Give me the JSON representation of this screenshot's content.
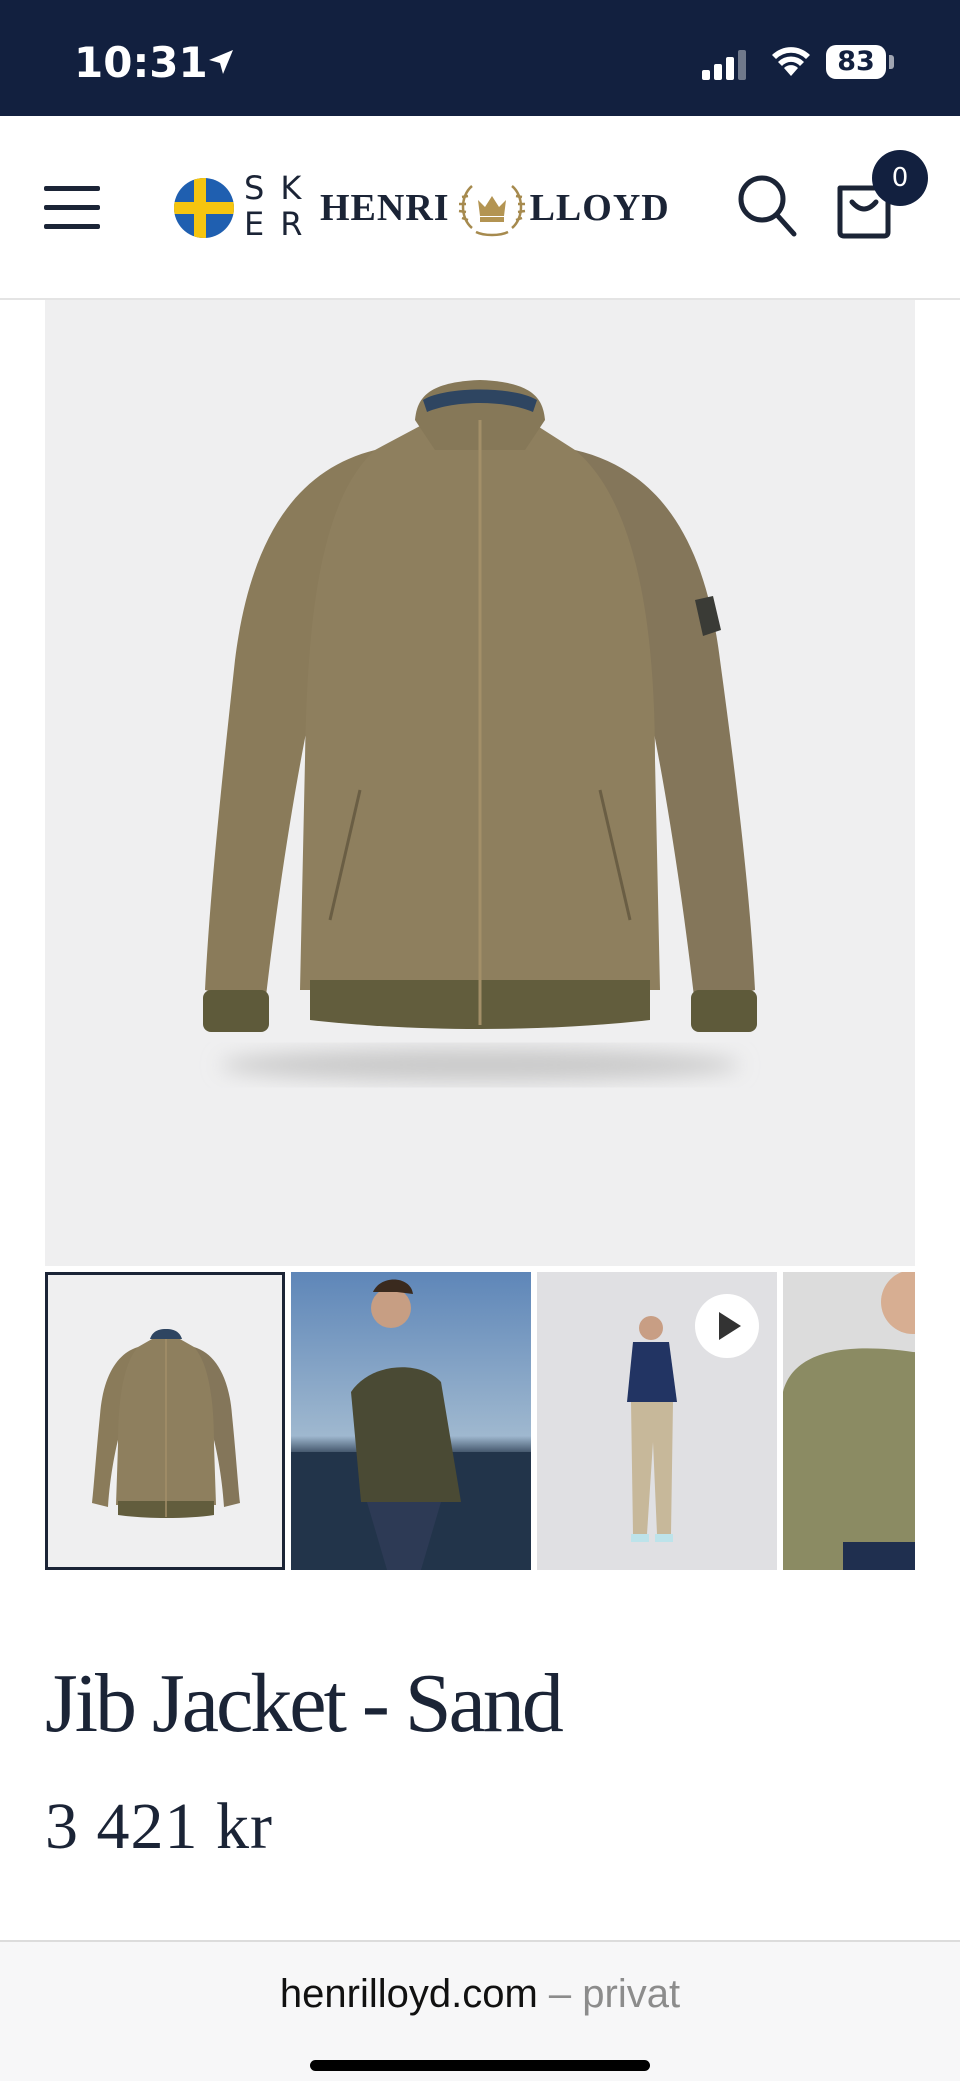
{
  "status_bar": {
    "time": "10:31",
    "battery": "83"
  },
  "header": {
    "lang_letters": [
      "S",
      "K",
      "E",
      "R"
    ],
    "brand_left": "HENRI",
    "brand_right": "LLOYD",
    "cart_count": "0"
  },
  "product": {
    "title": "Jib Jacket - Sand",
    "price": "3 421 kr"
  },
  "url_bar": {
    "domain": "henrilloyd.com",
    "mode": "– privat"
  },
  "colors": {
    "navy": "#12203f",
    "jacket": "#8c7d5c",
    "background": "#efeff0"
  },
  "icons": [
    "location-arrow-icon",
    "signal-icon",
    "wifi-icon",
    "battery-icon",
    "hamburger-icon",
    "sweden-flag-icon",
    "crest-logo-icon",
    "search-icon",
    "shopping-bag-icon",
    "play-icon"
  ]
}
